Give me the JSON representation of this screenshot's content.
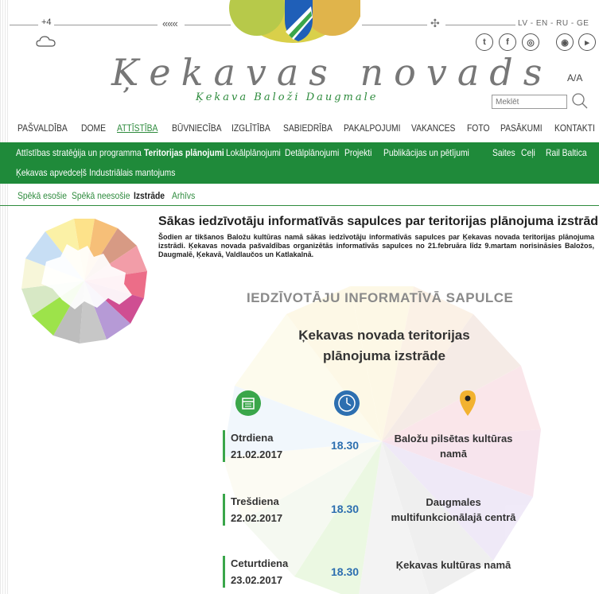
{
  "header": {
    "temperature": "+4",
    "weather_icon": "cloud-icon",
    "languages": "LV - EN - RU - GE",
    "logo_text": "Ķekavas novads",
    "logo_subtext": "Ķekava  Baloži  Daugmale",
    "font_size_toggle": "A/A",
    "search_placeholder": "Meklēt",
    "social": [
      "twitter-icon",
      "facebook-icon",
      "instagram-icon",
      "camera-icon",
      "video-icon"
    ]
  },
  "main_nav": [
    "PAŠVALDĪBA",
    "DOME",
    "ATTĪSTĪBA",
    "BŪVNIECĪBA",
    "IZGLĪTĪBA",
    "SABIEDRĪBA",
    "PAKALPOJUMI",
    "VAKANCES",
    "FOTO",
    "PASĀKUMI",
    "KONTAKTI"
  ],
  "sub_nav": [
    "Attīstības stratēģija un programma",
    "Teritorijas plānojumi",
    "Lokālplānojumi",
    "Detālplānojumi",
    "Projekti",
    "Publikācijas un pētījumi",
    "Saites",
    "Ceļi",
    "Rail Baltica",
    "Ķekavas apvedceļš",
    "Industriālais mantojums"
  ],
  "third_nav": [
    "Spēkā esošie",
    "Spēkā neesošie",
    "Izstrāde",
    "Arhīvs"
  ],
  "article": {
    "title": "Sākas iedzīvotāju informatīvās sapulces par teritorijas plānojuma izstrādi",
    "text": "Šodien ar tikšanos Baložu kultūras namā sākas iedzīvotāju informatīvās sapulces par Ķekavas novada teritorijas plānojuma izstrādi. Ķekavas novada pašvaldības organizētās informatīvās sapulces no 21.februāra līdz 9.martam norisināsies Baložos, Daugmalē, Ķekavā, Valdlaučos un Katlakalnā."
  },
  "poster": {
    "heading": "IEDZĪVOTĀJU INFORMATĪVĀ SAPULCE",
    "title": "Ķekavas novada teritorijas plānojuma izstrāde",
    "icons": [
      "calendar-icon",
      "clock-icon",
      "location-pin-icon"
    ],
    "events": [
      {
        "day": "Otrdiena",
        "date": "21.02.2017",
        "time": "18.30",
        "place": "Baložu pilsētas kultūras namā"
      },
      {
        "day": "Trešdiena",
        "date": "22.02.2017",
        "time": "18.30",
        "place": "Daugmales multifunkcionālajā centrā"
      },
      {
        "day": "Ceturtdiena",
        "date": "23.02.2017",
        "time": "18.30",
        "place": "Ķekavas kultūras namā"
      }
    ]
  },
  "colors": {
    "brand_green": "#1f8a3a",
    "time_blue": "#2d6fb0"
  }
}
